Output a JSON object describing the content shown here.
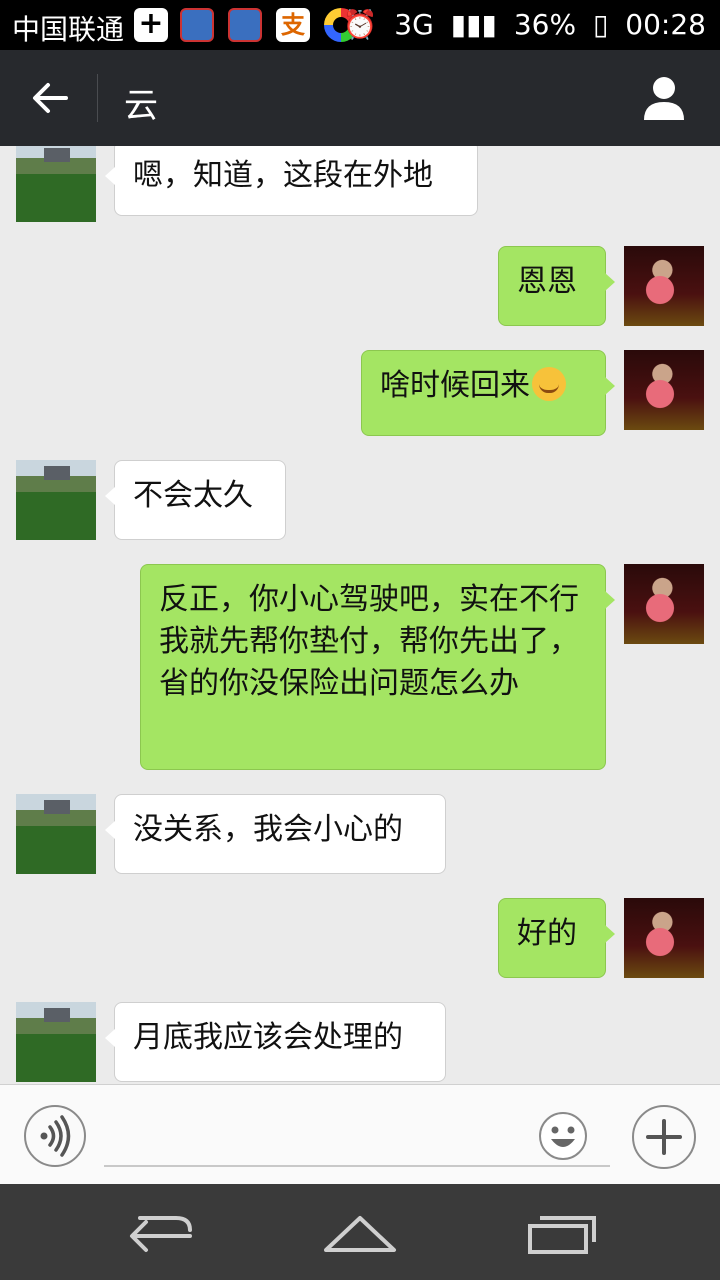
{
  "status_bar": {
    "carrier": "中国联通",
    "network": "3G",
    "battery": "36%",
    "time": "00:28"
  },
  "header": {
    "title": "云"
  },
  "messages": [
    {
      "side": "in",
      "text": "嗯，知道，这段在外地"
    },
    {
      "side": "out",
      "text": "恩恩"
    },
    {
      "side": "out",
      "text": "啥时候回来",
      "emoji": "smiling-face-emoji"
    },
    {
      "side": "in",
      "text": "不会太久"
    },
    {
      "side": "out",
      "text": "反正，你小心驾驶吧，实在不行我就先帮你垫付，帮你先出了，省的你没保险出问题怎么办"
    },
    {
      "side": "in",
      "text": "没关系，我会小心的"
    },
    {
      "side": "out",
      "text": "好的"
    },
    {
      "side": "in",
      "text": "月底我应该会处理的"
    }
  ],
  "input_bar": {
    "voice_icon": "voice-icon",
    "emoji_icon": "emoji-icon",
    "plus_icon": "plus-icon"
  },
  "nav_bar": {
    "icons": [
      "back-nav-icon",
      "home-nav-icon",
      "recents-nav-icon"
    ]
  }
}
